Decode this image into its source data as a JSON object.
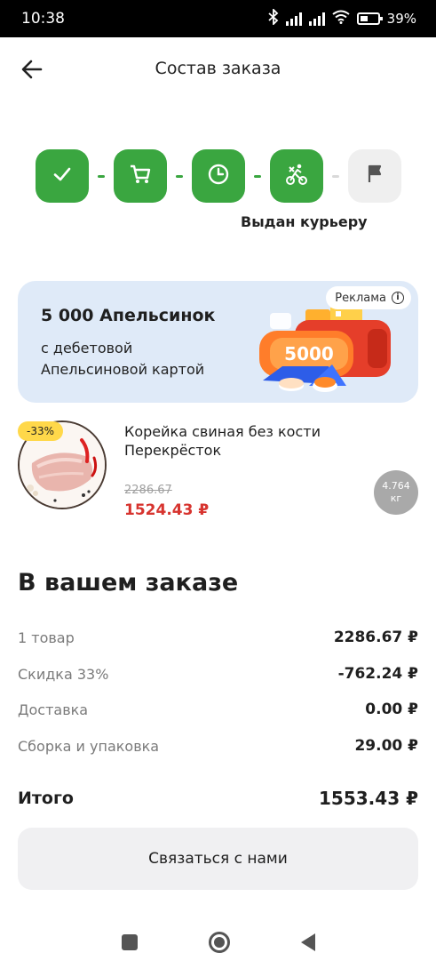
{
  "status_bar": {
    "time": "10:38",
    "battery": "39%"
  },
  "header": {
    "title": "Состав заказа"
  },
  "steps": {
    "current_label": "Выдан курьеру",
    "items": [
      {
        "icon": "check-icon",
        "state": "done"
      },
      {
        "icon": "cart-icon",
        "state": "done"
      },
      {
        "icon": "clock-icon",
        "state": "done"
      },
      {
        "icon": "courier-bike-icon",
        "state": "done"
      },
      {
        "icon": "flag-icon",
        "state": "pending"
      }
    ]
  },
  "promo": {
    "title": "5 000 Апельсинок",
    "subtitle": "с дебетовой Апельсиновой картой",
    "ad_label": "Реклама",
    "badge_number": "5000"
  },
  "product": {
    "discount": "-33%",
    "name": "Корейка свиная без кости Перекрёсток",
    "old_price": "2286.67",
    "new_price": "1524.43 ₽",
    "qty_value": "4.764",
    "qty_unit": "кг"
  },
  "summary": {
    "title": "В вашем заказе",
    "rows": [
      {
        "label": "1 товар",
        "value": "2286.67 ₽"
      },
      {
        "label": "Скидка 33%",
        "value": "-762.24 ₽"
      },
      {
        "label": "Доставка",
        "value": "0.00 ₽"
      },
      {
        "label": "Сборка и упаковка",
        "value": "29.00 ₽"
      }
    ],
    "total_label": "Итого",
    "total_value": "1553.43 ₽"
  },
  "contact_button": "Связаться с нами",
  "colors": {
    "accent_green": "#3aa640",
    "price_red": "#d7342f",
    "promo_bg": "#dfeaf8"
  }
}
